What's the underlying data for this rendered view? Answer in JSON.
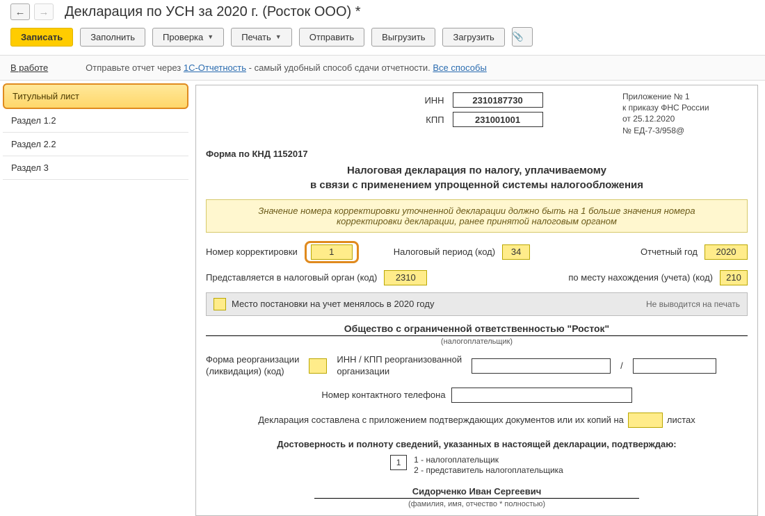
{
  "header": {
    "title": "Декларация по УСН за 2020 г. (Росток ООО) *"
  },
  "toolbar": {
    "save": "Записать",
    "fill": "Заполнить",
    "check": "Проверка",
    "print": "Печать",
    "send": "Отправить",
    "export": "Выгрузить",
    "import": "Загрузить"
  },
  "subbar": {
    "status": "В работе",
    "text_before": "Отправьте отчет через ",
    "link1": "1С-Отчетность",
    "text_after": " - самый удобный способ сдачи отчетности. ",
    "link2": "Все способы"
  },
  "sidebar": {
    "items": [
      {
        "label": "Титульный лист"
      },
      {
        "label": "Раздел 1.2"
      },
      {
        "label": "Раздел 2.2"
      },
      {
        "label": "Раздел 3"
      }
    ]
  },
  "ids": {
    "inn_label": "ИНН",
    "inn": "2310187730",
    "kpp_label": "КПП",
    "kpp": "231001001"
  },
  "appendix": {
    "l1": "Приложение № 1",
    "l2": "к приказу ФНС России",
    "l3": "от 25.12.2020",
    "l4": "№ ЕД-7-3/958@"
  },
  "form_code": "Форма по КНД 1152017",
  "decl_title_l1": "Налоговая декларация по налогу, уплачиваемому",
  "decl_title_l2": "в связи с применением упрощенной системы налогообложения",
  "warn_l1": "Значение номера корректировки уточненной декларации должно быть на 1 больше значения номера",
  "warn_l2": "корректировки декларации, ранее принятой налоговым органом",
  "fields": {
    "corr_label": "Номер корректировки",
    "corr_value": "1",
    "period_label": "Налоговый период (код)",
    "period_value": "34",
    "year_label": "Отчетный год",
    "year_value": "2020",
    "organ_label": "Представляется в налоговый орган (код)",
    "organ_value": "2310",
    "place_label": "по месту нахождения (учета) (код)",
    "place_value": "210"
  },
  "gray": {
    "checkbox_label": "Место постановки на учет менялось в 2020 году",
    "right": "Не выводится на печать"
  },
  "org": {
    "name": "Общество с ограниченной ответственностью \"Росток\"",
    "sub": "(налогоплательщик)"
  },
  "reorg": {
    "form_label_l1": "Форма реорганизации",
    "form_label_l2": "(ликвидация) (код)",
    "inn_label_l1": "ИНН / КПП реорганизованной",
    "inn_label_l2": "организации",
    "slash": "/"
  },
  "phone_label": "Номер контактного телефона",
  "attach_text_before": "Декларация составлена с приложением подтверждающих документов или их копий на",
  "attach_text_after": "листах",
  "confirm_title": "Достоверность и полноту сведений, указанных в настоящей декларации, подтверждаю:",
  "confirm_value": "1",
  "confirm_opt1": "1 - налогоплательщик",
  "confirm_opt2": "2 - представитель налогоплательщика",
  "signer": {
    "name": "Сидорченко Иван Сергеевич",
    "sub": "(фамилия, имя, отчество * полностью)"
  }
}
